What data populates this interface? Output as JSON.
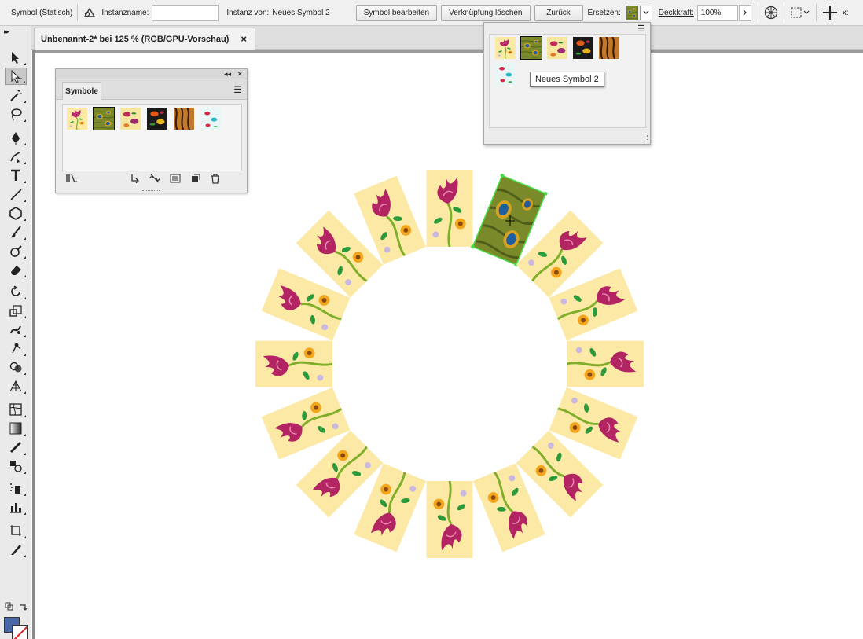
{
  "control_bar": {
    "object_type": "Symbol (Statisch)",
    "instance_name_label": "Instanzname:",
    "instance_name_value": "",
    "instance_of_label": "Instanz von:",
    "instance_of_value": "Neues Symbol 2",
    "edit_symbol_label": "Symbol bearbeiten",
    "break_link_label": "Verknüpfung löschen",
    "reset_label": "Zurück",
    "replace_label": "Ersetzen:",
    "opacity_label": "Deckkraft:",
    "opacity_value": "100%",
    "x_label": "x:"
  },
  "document_tab": {
    "title": "Unbenannt-2* bei 125 % (RGB/GPU-Vorschau)",
    "close": "×"
  },
  "tools": [
    {
      "name": "selection-tool-icon",
      "active": false
    },
    {
      "name": "direct-selection-tool-icon",
      "active": true
    },
    {
      "name": "magic-wand-tool-icon",
      "active": false
    },
    {
      "name": "lasso-tool-icon",
      "active": false
    },
    {
      "name": "pen-tool-icon",
      "active": false
    },
    {
      "name": "curvature-tool-icon",
      "active": false
    },
    {
      "name": "type-tool-icon",
      "active": false
    },
    {
      "name": "line-segment-tool-icon",
      "active": false
    },
    {
      "name": "polygon-tool-icon",
      "active": false
    },
    {
      "name": "paintbrush-tool-icon",
      "active": false
    },
    {
      "name": "blob-brush-tool-icon",
      "active": false
    },
    {
      "name": "eraser-tool-icon",
      "active": false
    },
    {
      "name": "rotate-tool-icon",
      "active": false
    },
    {
      "name": "scale-tool-icon",
      "active": false
    },
    {
      "name": "warp-tool-icon",
      "active": false
    },
    {
      "name": "puppet-warp-tool-icon",
      "active": false
    },
    {
      "name": "shape-builder-tool-icon",
      "active": false
    },
    {
      "name": "perspective-grid-tool-icon",
      "active": false
    },
    {
      "name": "mesh-tool-icon",
      "active": false
    },
    {
      "name": "gradient-tool-icon",
      "active": false
    },
    {
      "name": "eyedropper-tool-icon",
      "active": false
    },
    {
      "name": "blend-tool-icon",
      "active": false
    },
    {
      "name": "symbol-sprayer-tool-icon",
      "active": false
    },
    {
      "name": "column-graph-tool-icon",
      "active": false
    },
    {
      "name": "artboard-tool-icon",
      "active": false
    },
    {
      "name": "slice-tool-icon",
      "active": false
    },
    {
      "name": "hand-tool-icon",
      "active": false
    },
    {
      "name": "zoom-tool-icon",
      "active": false
    }
  ],
  "colors": {
    "fill": "#4a68a8",
    "stroke": "none",
    "selection": "#44dd44",
    "symbol_bg": "#fce9a6",
    "tulip": "#b32463",
    "stem": "#7fae2a",
    "peacock_bg": "#7a8a2a",
    "peacock_eye": "#1f5fa0"
  },
  "symbols_panel": {
    "tab_label": "Symbole",
    "symbols": [
      {
        "name": "floral-yellow",
        "selected": false
      },
      {
        "name": "peacock",
        "selected": true
      },
      {
        "name": "floral-pink",
        "selected": false
      },
      {
        "name": "floral-dark",
        "selected": false
      },
      {
        "name": "tiger-stripes",
        "selected": false
      },
      {
        "name": "floral-cyan",
        "selected": false
      }
    ]
  },
  "replace_dropdown": {
    "tooltip": "Neues Symbol 2",
    "symbols": [
      "floral-yellow",
      "peacock",
      "floral-pink",
      "floral-dark",
      "tiger-stripes",
      "floral-cyan"
    ]
  },
  "artwork": {
    "ring_count": 16,
    "highlighted_index": 1
  }
}
